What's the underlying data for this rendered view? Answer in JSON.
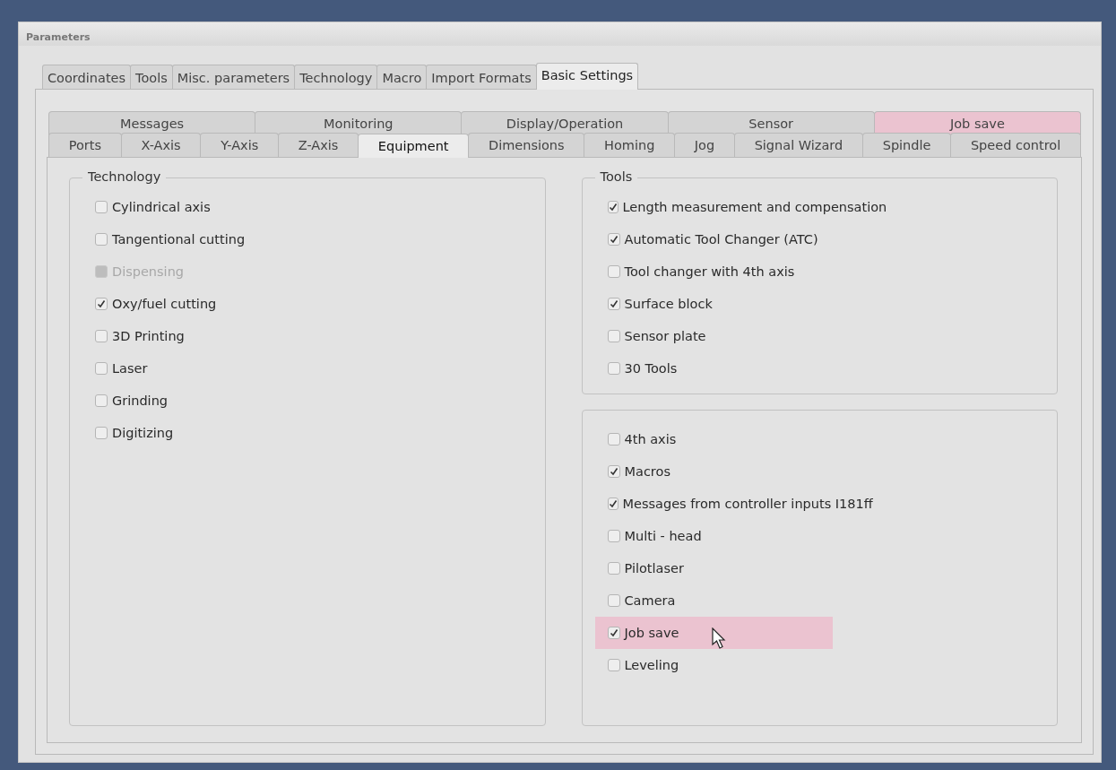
{
  "window": {
    "title": "Parameters"
  },
  "main_tabs": [
    {
      "label": "Coordinates",
      "selected": false
    },
    {
      "label": "Tools",
      "selected": false
    },
    {
      "label": "Misc. parameters",
      "selected": false
    },
    {
      "label": "Technology",
      "selected": false
    },
    {
      "label": "Macro",
      "selected": false
    },
    {
      "label": "Import Formats",
      "selected": false
    },
    {
      "label": "Basic Settings",
      "selected": true
    }
  ],
  "sub_tabs_back": [
    {
      "label": "Messages",
      "selected": false,
      "highlighted": false
    },
    {
      "label": "Monitoring",
      "selected": false,
      "highlighted": false
    },
    {
      "label": "Display/Operation",
      "selected": false,
      "highlighted": false
    },
    {
      "label": "Sensor",
      "selected": false,
      "highlighted": false
    },
    {
      "label": "Job save",
      "selected": false,
      "highlighted": true
    }
  ],
  "sub_tabs_front": [
    {
      "label": "Ports",
      "selected": false
    },
    {
      "label": "X-Axis",
      "selected": false
    },
    {
      "label": "Y-Axis",
      "selected": false
    },
    {
      "label": "Z-Axis",
      "selected": false
    },
    {
      "label": "Equipment",
      "selected": true
    },
    {
      "label": "Dimensions",
      "selected": false
    },
    {
      "label": "Homing",
      "selected": false
    },
    {
      "label": "Jog",
      "selected": false
    },
    {
      "label": "Signal Wizard",
      "selected": false
    },
    {
      "label": "Spindle",
      "selected": false
    },
    {
      "label": "Speed control",
      "selected": false
    }
  ],
  "groups": [
    {
      "title": "Technology",
      "items": [
        {
          "label": "Cylindrical axis",
          "checked": false,
          "disabled": false,
          "highlighted": false
        },
        {
          "label": "Tangentional cutting",
          "checked": false,
          "disabled": false,
          "highlighted": false
        },
        {
          "label": "Dispensing",
          "checked": false,
          "disabled": true,
          "highlighted": false
        },
        {
          "label": "Oxy/fuel cutting",
          "checked": true,
          "disabled": false,
          "highlighted": false
        },
        {
          "label": "3D Printing",
          "checked": false,
          "disabled": false,
          "highlighted": false
        },
        {
          "label": "Laser",
          "checked": false,
          "disabled": false,
          "highlighted": false
        },
        {
          "label": "Grinding",
          "checked": false,
          "disabled": false,
          "highlighted": false
        },
        {
          "label": "Digitizing",
          "checked": false,
          "disabled": false,
          "highlighted": false
        }
      ]
    },
    {
      "title": "Tools",
      "items": [
        {
          "label": "Length measurement and compensation",
          "checked": true,
          "disabled": false,
          "highlighted": false
        },
        {
          "label": "Automatic Tool Changer (ATC)",
          "checked": true,
          "disabled": false,
          "highlighted": false
        },
        {
          "label": "Tool changer with 4th axis",
          "checked": false,
          "disabled": false,
          "highlighted": false
        },
        {
          "label": "Surface block",
          "checked": true,
          "disabled": false,
          "highlighted": false
        },
        {
          "label": "Sensor plate",
          "checked": false,
          "disabled": false,
          "highlighted": false
        },
        {
          "label": "30 Tools",
          "checked": false,
          "disabled": false,
          "highlighted": false
        }
      ]
    },
    {
      "items": [
        {
          "label": "4th axis",
          "checked": false,
          "disabled": false,
          "highlighted": false
        },
        {
          "label": "Macros",
          "checked": true,
          "disabled": false,
          "highlighted": false
        },
        {
          "label": "Messages from controller inputs I181ff",
          "checked": true,
          "disabled": false,
          "highlighted": false
        },
        {
          "label": "Multi - head",
          "checked": false,
          "disabled": false,
          "highlighted": false
        },
        {
          "label": "Pilotlaser",
          "checked": false,
          "disabled": false,
          "highlighted": false
        },
        {
          "label": "Camera",
          "checked": false,
          "disabled": false,
          "highlighted": false
        },
        {
          "label": "Job save",
          "checked": true,
          "disabled": false,
          "highlighted": true
        },
        {
          "label": "Leveling",
          "checked": false,
          "disabled": false,
          "highlighted": false
        }
      ]
    }
  ]
}
